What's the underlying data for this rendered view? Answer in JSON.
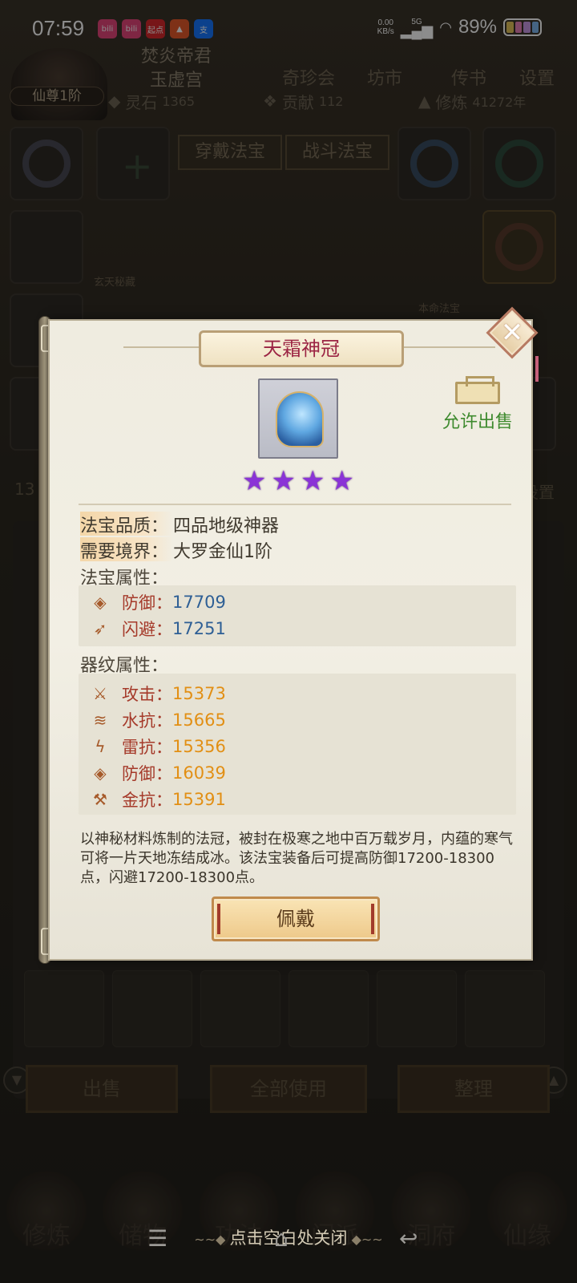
{
  "status_bar": {
    "time": "07:59",
    "net_speed_value": "0.00",
    "net_speed_unit": "KB/s",
    "network": "5G",
    "battery_percent": "89%",
    "app_icons": [
      {
        "name": "bilibili-icon",
        "label": "bili",
        "color": "#e6457a"
      },
      {
        "name": "bilibili-icon",
        "label": "bili",
        "color": "#e6457a"
      },
      {
        "name": "qidian-icon",
        "label": "起点",
        "color": "#d9292d"
      },
      {
        "name": "taobao-icon",
        "label": "▲",
        "color": "#e55a2b"
      },
      {
        "name": "alipay-icon",
        "label": "支",
        "color": "#1677ff"
      }
    ]
  },
  "header": {
    "player_name": "焚炎帝君",
    "sect": "玉虚宫",
    "realm": "仙尊1阶",
    "menu": [
      "奇珍会",
      "坊市",
      "传书",
      "设置"
    ],
    "resources": [
      {
        "label": "灵石",
        "value": "1365"
      },
      {
        "label": "贡献",
        "value": "112"
      },
      {
        "label": "修炼",
        "value": "41272年"
      }
    ]
  },
  "equipment": {
    "tabs": [
      "穿戴法宝",
      "战斗法宝"
    ],
    "side_labels": [
      "玄天秘藏",
      "本命法宝"
    ]
  },
  "bag": {
    "actions": [
      "出售",
      "全部使用",
      "整理"
    ],
    "side_number": "13",
    "side_text": "设置"
  },
  "bottom_nav": [
    "修炼",
    "储物",
    "功法",
    "门派",
    "洞府",
    "仙缘"
  ],
  "close_hint": "点击空白处关闭",
  "dialog": {
    "title": "天霜神冠",
    "sell_status": "允许出售",
    "stars": 4,
    "star_glyph": "★",
    "quality_label": "法宝品质：",
    "quality_value": "四品地级神器",
    "realm_label": "需要境界：",
    "realm_value": "大罗金仙1阶",
    "base_title": "法宝属性：",
    "base_stats": [
      {
        "icon": "armor-icon",
        "glyph": "◈",
        "name": "防御：",
        "value": "17709"
      },
      {
        "icon": "dodge-icon",
        "glyph": "➶",
        "name": "闪避：",
        "value": "17251"
      }
    ],
    "rune_title": "器纹属性：",
    "rune_stats": [
      {
        "icon": "attack-icon",
        "glyph": "⚔",
        "name": "攻击：",
        "value": "15373"
      },
      {
        "icon": "water-icon",
        "glyph": "≋",
        "name": "水抗：",
        "value": "15665"
      },
      {
        "icon": "thunder-icon",
        "glyph": "ϟ",
        "name": "雷抗：",
        "value": "15356"
      },
      {
        "icon": "armor-icon",
        "glyph": "◈",
        "name": "防御：",
        "value": "16039"
      },
      {
        "icon": "metal-icon",
        "glyph": "⚒",
        "name": "金抗：",
        "value": "15391"
      }
    ],
    "description": "以神秘材料炼制的法冠，被封在极寒之地中百万载岁月，内蕴的寒气可将一片天地冻结成冰。该法宝装备后可提高防御17200-18300点，闪避17200-18300点。",
    "equip_label": "佩戴",
    "close_glyph": "✕"
  },
  "colors": {
    "title": "#9b2443",
    "sell_green": "#3e8a2e",
    "base_value_blue": "#2e5f95",
    "rune_value_gold": "#e28f14",
    "star_purple": "#8a33d6"
  }
}
